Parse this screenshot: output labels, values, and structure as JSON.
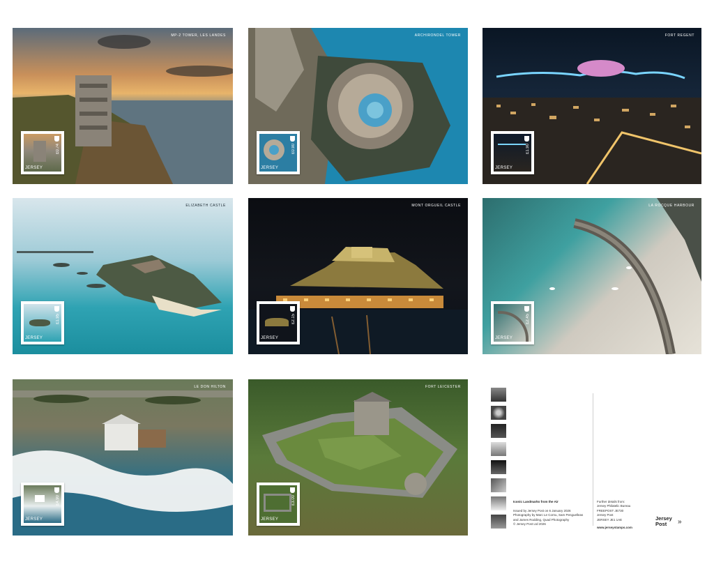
{
  "cards": [
    {
      "title": "MP-2 TOWER, LES LANDES",
      "value": "£0.74",
      "jersey": "JERSEY"
    },
    {
      "title": "ARCHIRONDEL TOWER",
      "value": "£0.90",
      "jersey": "JERSEY"
    },
    {
      "title": "FORT REGENT",
      "value": "£1.90",
      "jersey": "JERSEY"
    },
    {
      "title": "ELIZABETH CASTLE",
      "value": "£1.95",
      "jersey": "JERSEY"
    },
    {
      "title": "MONT ORGUEIL CASTLE",
      "value": "£2.15",
      "jersey": "JERSEY"
    },
    {
      "title": "LA ROCQUE HARBOUR",
      "value": "£2.45",
      "jersey": "JERSEY"
    },
    {
      "title": "LE DON HILTON",
      "value": "£4.90",
      "jersey": "JERSEY"
    },
    {
      "title": "FORT LEICESTER",
      "value": "£3.00",
      "jersey": "JERSEY"
    }
  ],
  "back": {
    "title": "Iconic Landmarks from the Air",
    "info": "Issued by Jersey Post on 6 January 2026\nPhotography by Marc Le Cornu, Sam Penguelleas\nand James Rodding, Quad Photography\n© Jersey Post Ltd 2026",
    "address": "Further details from:\nJersey Philatelic Bureau\nFREEPOST JE730\nJersey Post\nJERSEY JE1 1AE",
    "website": "www.jerseystamps.com",
    "logo_line1": "Jersey",
    "logo_line2": "Post"
  }
}
